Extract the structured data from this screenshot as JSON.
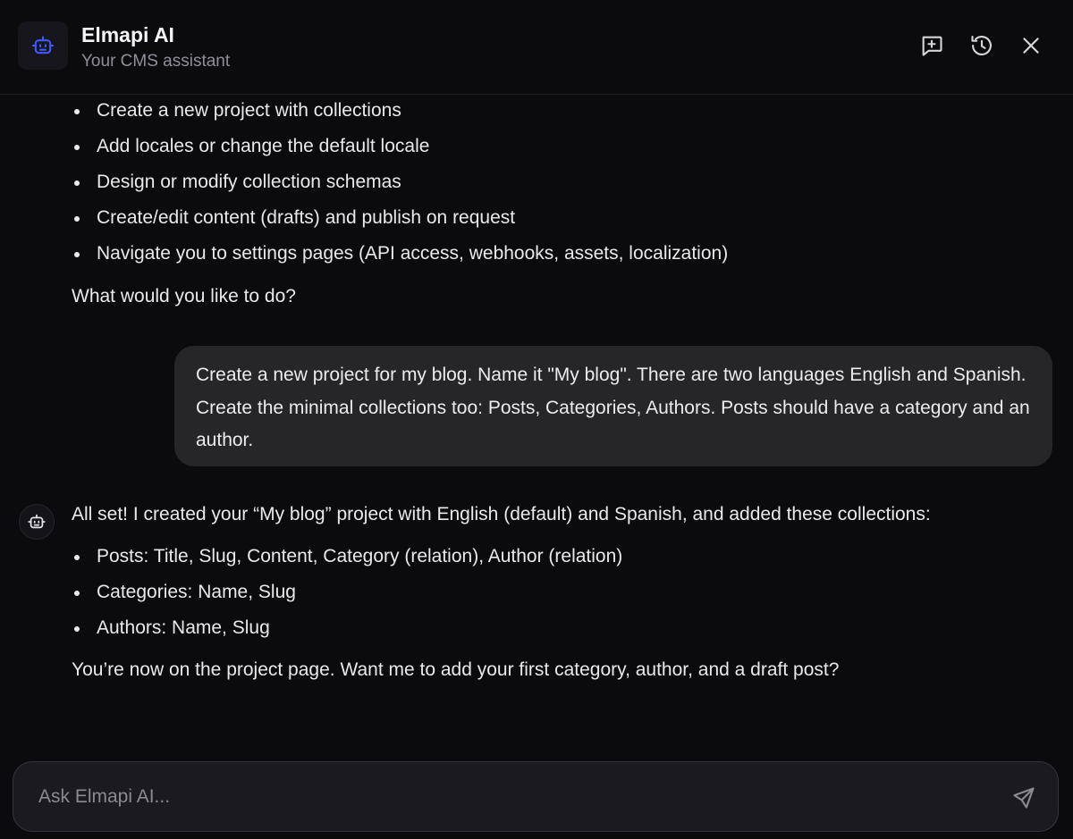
{
  "header": {
    "title": "Elmapi AI",
    "subtitle": "Your CMS assistant"
  },
  "colors": {
    "accent": "#3b5bff",
    "background": "#0b0b0e",
    "bubble": "#262629"
  },
  "icons": {
    "logo": "robot-icon",
    "new_chat": "new-chat-icon",
    "history": "history-icon",
    "close": "close-icon",
    "bot_avatar": "robot-icon",
    "send": "send-icon"
  },
  "messages": {
    "intro_bullets": [
      "Create a new project with collections",
      "Add locales or change the default locale",
      "Design or modify collection schemas",
      "Create/edit content (drafts) and publish on request",
      "Navigate you to settings pages (API access, webhooks, assets, localization)"
    ],
    "intro_question": "What would you like to do?",
    "user_message": "Create a new project for my blog. Name it \"My blog\". There are two languages English and Spanish. Create the minimal collections too: Posts, Categories, Authors. Posts should have a category and an author.",
    "bot_reply_intro": "All set! I created your “My blog” project with English (default) and Spanish, and added these collections:",
    "bot_reply_bullets": [
      "Posts: Title, Slug, Content, Category (relation), Author (relation)",
      "Categories: Name, Slug",
      "Authors: Name, Slug"
    ],
    "bot_reply_outro": "You’re now on the project page. Want me to add your first category, author, and a draft post?"
  },
  "composer": {
    "placeholder": "Ask Elmapi AI...",
    "value": ""
  }
}
